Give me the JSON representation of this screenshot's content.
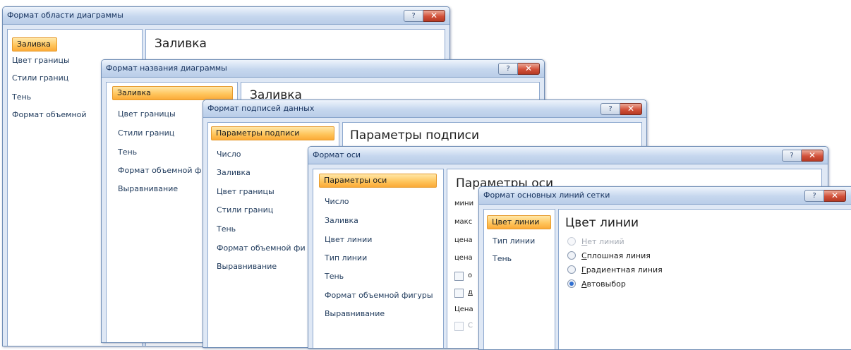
{
  "dialogs": {
    "chart_area": {
      "title": "Формат области диаграммы",
      "nav": [
        "Заливка",
        "Цвет границы",
        "Стили границ",
        "Тень",
        "Формат объемной"
      ],
      "section_title": "Заливка"
    },
    "chart_title": {
      "title": "Формат названия диаграммы",
      "nav": [
        "Заливка",
        "Цвет границы",
        "Стили границ",
        "Тень",
        "Формат объемной ф",
        "Выравнивание"
      ],
      "section_title": "Заливка"
    },
    "data_labels": {
      "title": "Формат подписей данных",
      "nav": [
        "Параметры подписи",
        "Число",
        "Заливка",
        "Цвет границы",
        "Стили границ",
        "Тень",
        "Формат объемной фи",
        "Выравнивание"
      ],
      "section_title": "Параметры подписи"
    },
    "axis": {
      "title": "Формат оси",
      "nav": [
        "Параметры оси",
        "Число",
        "Заливка",
        "Цвет линии",
        "Тип линии",
        "Тень",
        "Формат объемной фигуры",
        "Выравнивание"
      ],
      "section_title": "Параметры оси",
      "partial_labels": [
        "мини",
        "макс",
        "цена",
        "цена",
        "о",
        "д",
        "Цена",
        "С"
      ]
    },
    "gridlines": {
      "title": "Формат основных линий сетки",
      "nav": [
        "Цвет линии",
        "Тип линии",
        "Тень"
      ],
      "section_title": "Цвет линии",
      "options": [
        {
          "key": "Н",
          "rest": "ет линий"
        },
        {
          "key": "С",
          "rest": "плошная линия"
        },
        {
          "key": "Г",
          "rest": "радиентная линия"
        },
        {
          "key": "А",
          "rest": "втовыбор"
        }
      ]
    }
  },
  "titlebar": {
    "help_glyph": "?",
    "close_glyph": "✕"
  }
}
